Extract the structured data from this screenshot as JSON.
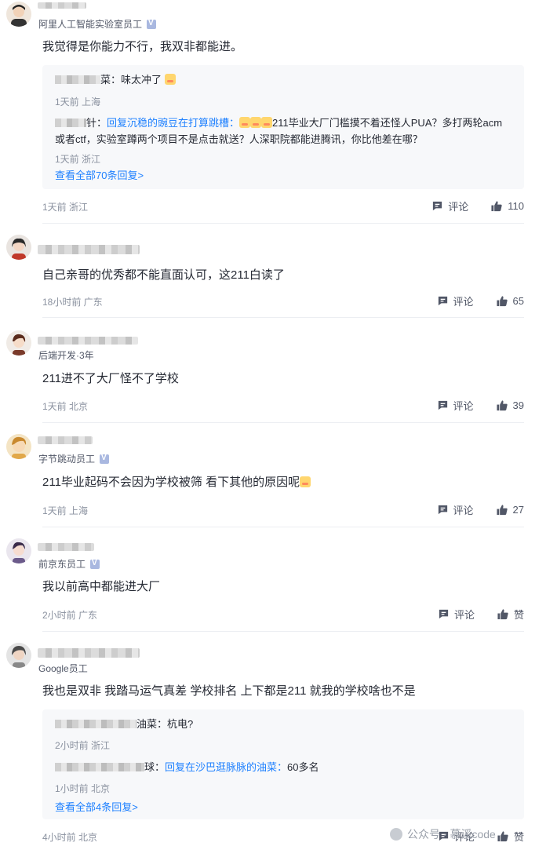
{
  "comments": [
    {
      "title": "阿里人工智能实验室员工",
      "content": "我觉得是你能力不行，我双非都能进。",
      "time": "1天前 浙江",
      "comment_label": "评论",
      "likes": "110",
      "replies": [
        {
          "text_suffix": "菜：味太冲了",
          "meta": "1天前 上海"
        },
        {
          "name_fragment": "针：",
          "reply_to": "回复沉稳的豌豆在打算跳槽：",
          "text": "211毕业大厂门槛摸不着还怪人PUA？多打两轮acm",
          "text2": "或者ctf，实验室蹲两个项目不是点击就送？人深职院都能进腾讯，你比他差在哪？",
          "meta": "1天前 浙江"
        }
      ],
      "view_all": "查看全部70条回复>"
    },
    {
      "title": "",
      "content": "自己亲哥的优秀都不能直面认可，这211白读了",
      "time": "18小时前 广东",
      "comment_label": "评论",
      "likes": "65"
    },
    {
      "title": "后端开发·3年",
      "content": "211进不了大厂怪不了学校",
      "time": "1天前 北京",
      "comment_label": "评论",
      "likes": "39"
    },
    {
      "title": "字节跳动员工",
      "content": "211毕业起码不会因为学校被筛 看下其他的原因呢",
      "time": "1天前 上海",
      "comment_label": "评论",
      "likes": "27"
    },
    {
      "title": "前京东员工",
      "content": "我以前高中都能进大厂",
      "time": "2小时前 广东",
      "comment_label": "评论",
      "likes": "赞"
    },
    {
      "title": "Google员工",
      "content": "我也是双非 我踏马运气真差 学校排名 上下都是211 就我的学校啥也不是",
      "time": "4小时前 北京",
      "comment_label": "评论",
      "likes": "赞",
      "replies": [
        {
          "text_suffix": "油菜：杭电?",
          "meta": "2小时前 浙江"
        },
        {
          "name_fragment": "球：",
          "reply_to": "回复在沙巴逛脉脉的油菜：",
          "text": "60多名",
          "meta": "1小时前 北京"
        }
      ],
      "view_all": "查看全部4条回复>"
    }
  ],
  "watermark": "公众号 · 慕溪code",
  "colors": {
    "accent": "#1e80ff",
    "text": "#252933",
    "muted": "#8a919f"
  }
}
